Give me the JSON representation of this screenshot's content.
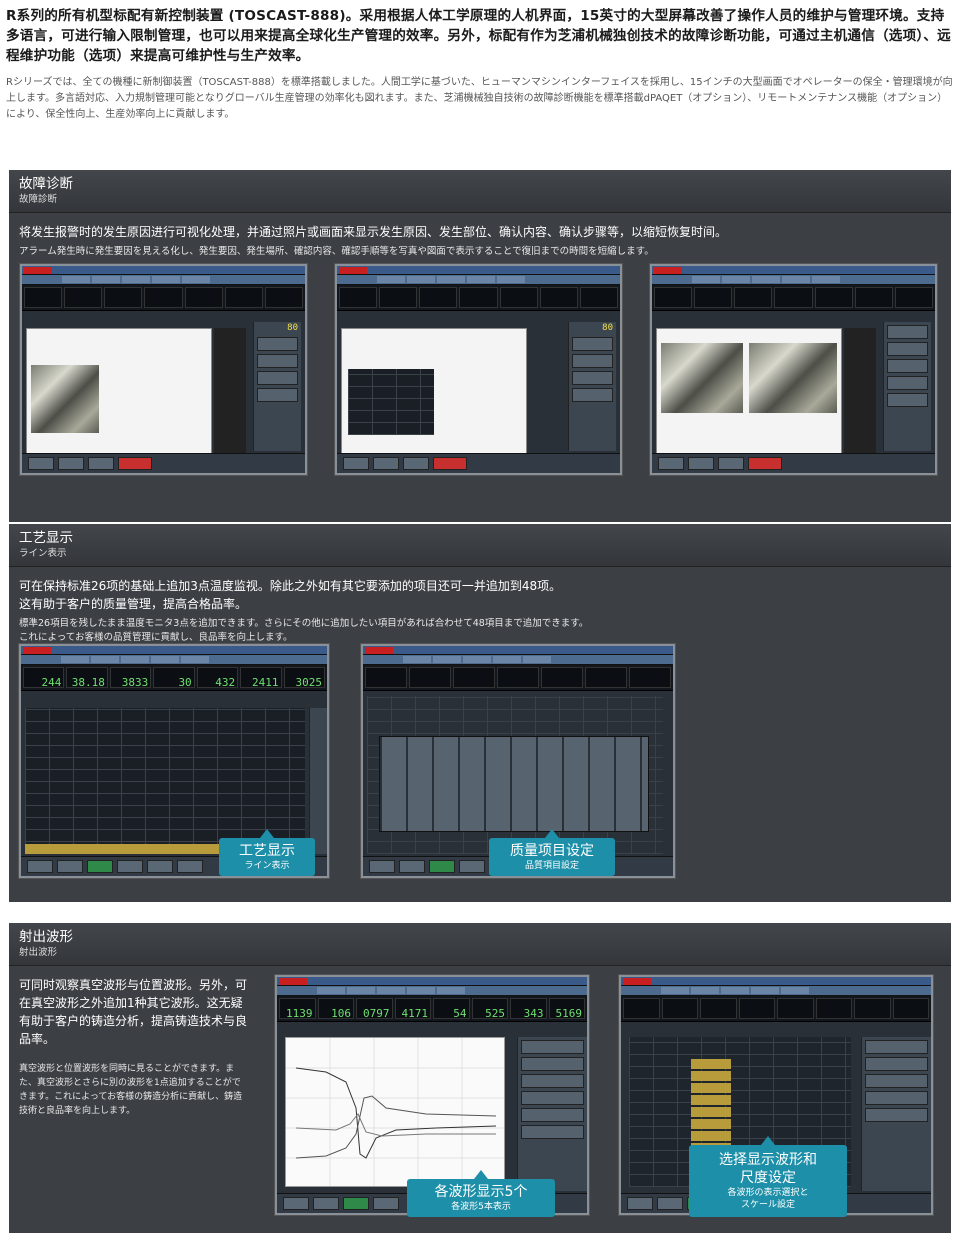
{
  "intro": {
    "zh": "R系列的所有机型标配有新控制装置 (TOSCAST-888)。采用根据人体工学原理的人机界面，15英寸的大型屏幕改善了操作人员的维护与管理环境。支持多语言，可进行输入限制管理，也可以用来提高全球化生产管理的效率。另外，标配有作为芝浦机械独创技术的故障诊断功能，可通过主机通信（选项）、远程维护功能（选项）来提高可维护性与生产效率。",
    "ja": "Rシリーズでは、全ての機種に新制御装置（TOSCAST-888）を標準搭載しました。人間工学に基づいた、ヒューマンマシンインターフェイスを採用し、15インチの大型画面でオペレーターの保全・管理環境が向上します。多言語対応、入力規制管理可能となりグローバル生産管理の効率化も図れます。また、芝浦機械独自技術の故障診断機能を標準搭載dPAQET（オプション）、リモートメンテナンス機能（オプション）により、保全性向上、生産効率向上に貢献します。"
  },
  "sections": {
    "fault": {
      "title": "故障诊断",
      "subtitle": "故障診断",
      "desc_zh": "将发生报警时的发生原因进行可视化处理，并通过照片或画面来显示发生原因、发生部位、确认内容、确认步骤等，以缩短恢复时间。",
      "desc_ja": "アラーム発生時に発生要因を見える化し、発生要因、発生場所、確認内容、確認手順等を写真や図面で表示することで復旧までの時間を短縮します。",
      "screen_value": "80"
    },
    "process": {
      "title": "工艺显示",
      "subtitle": "ライン表示",
      "desc_zh_1": "可在保持标准26项的基础上追加3点温度监视。除此之外如有其它要添加的项目还可一并追加到48项。",
      "desc_zh_2": "这有助于客户的质量管理，提高合格品率。",
      "desc_ja_1": "標準26項目を残したまま温度モニタ3点を追加できます。さらにその他に追加したい項目があれば合わせて48項目まで追加できます。",
      "desc_ja_2": "これによってお客様の品質管理に貢献し、良品率を向上します。",
      "gauge_values": [
        "244",
        "38.18",
        "3833",
        "30",
        "432",
        "2411",
        "3025"
      ],
      "callout1_title": "工艺显示",
      "callout1_sub": "ライン表示",
      "callout2_title": "质量项目设定",
      "callout2_sub": "品質項目設定"
    },
    "wave": {
      "title": "射出波形",
      "subtitle": "射出波形",
      "desc_zh": "可同时观察真空波形与位置波形。另外，可在真空波形之外追加1种其它波形。这无疑有助于客户的铸造分析，提高铸造技术与良品率。",
      "desc_ja": "真空波形と位置波形を同時に見ることができます。また、真空波形とさらに別の波形を1点追加することができます。これによってお客様の鋳造分析に貢献し、鋳造技術と良品率を向上します。",
      "gauge_values": [
        "1139",
        "106",
        "0797",
        "4171",
        "54",
        "525",
        "343",
        "5169"
      ],
      "callout1_title": "各波形显示5个",
      "callout1_sub": "各波形5本表示",
      "callout2_title_1": "选择显示波形和",
      "callout2_title_2": "尺度设定",
      "callout2_sub_1": "各波形の表示選択と",
      "callout2_sub_2": "スケール設定"
    }
  }
}
